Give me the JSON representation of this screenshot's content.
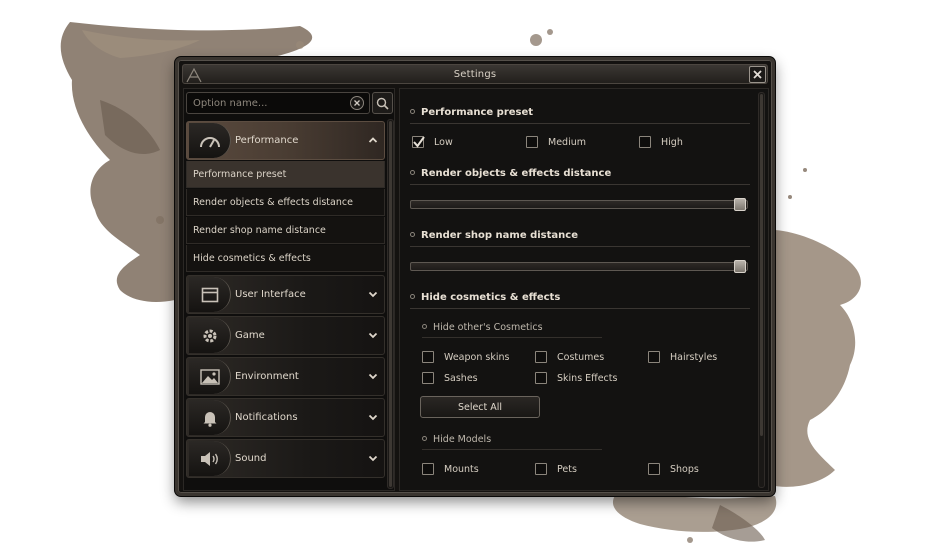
{
  "window": {
    "title": "Settings"
  },
  "search": {
    "placeholder": "Option name..."
  },
  "categories": [
    {
      "label": "Performance",
      "icon": "gauge-icon",
      "expanded": true,
      "items": [
        "Performance preset",
        "Render objects & effects distance",
        "Render shop name distance",
        "Hide cosmetics & effects"
      ],
      "selected_item": "Performance preset"
    },
    {
      "label": "User Interface",
      "icon": "window-icon",
      "expanded": false
    },
    {
      "label": "Game",
      "icon": "gear-icon",
      "expanded": false
    },
    {
      "label": "Environment",
      "icon": "landscape-icon",
      "expanded": false
    },
    {
      "label": "Notifications",
      "icon": "bell-icon",
      "expanded": false
    },
    {
      "label": "Sound",
      "icon": "speaker-icon",
      "expanded": false
    }
  ],
  "settings": {
    "preset": {
      "title": "Performance preset",
      "options": [
        {
          "label": "Low",
          "checked": true
        },
        {
          "label": "Medium",
          "checked": false
        },
        {
          "label": "High",
          "checked": false
        }
      ]
    },
    "render_distance": {
      "title": "Render objects & effects distance",
      "value": 1.0
    },
    "shop_distance": {
      "title": "Render shop name distance",
      "value": 1.0
    },
    "hide_cosmetics": {
      "title": "Hide cosmetics & effects",
      "others_title": "Hide other's Cosmetics",
      "others_options": [
        {
          "label": "Weapon skins",
          "checked": false
        },
        {
          "label": "Costumes",
          "checked": false
        },
        {
          "label": "Hairstyles",
          "checked": false
        },
        {
          "label": "Sashes",
          "checked": false
        },
        {
          "label": "Skins Effects",
          "checked": false
        }
      ],
      "select_all_label": "Select All",
      "models_title": "Hide Models",
      "models_options": [
        {
          "label": "Mounts",
          "checked": false
        },
        {
          "label": "Pets",
          "checked": false
        },
        {
          "label": "Shops",
          "checked": false
        }
      ]
    }
  },
  "colors": {
    "accent": "#4a3d33",
    "panel": "#141210",
    "backdrop_ink": "#8a7a6b"
  }
}
